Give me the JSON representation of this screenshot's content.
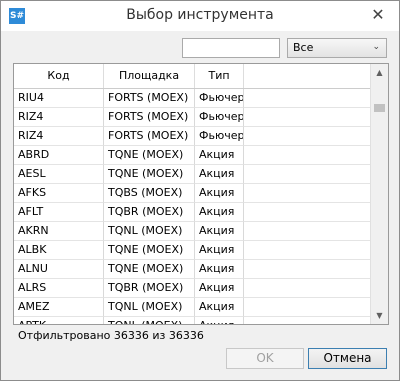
{
  "window": {
    "app_icon": "S#",
    "title": "Выбор инструмента",
    "close": "✕"
  },
  "filter": {
    "search_value": "",
    "combo_value": "Все"
  },
  "columns": [
    "Код",
    "Площадка",
    "Тип"
  ],
  "rows": [
    [
      "RIU4",
      "FORTS (MOEX)",
      "Фьючер"
    ],
    [
      "RIZ4",
      "FORTS (MOEX)",
      "Фьючер"
    ],
    [
      "RIZ4",
      "FORTS (MOEX)",
      "Фьючер"
    ],
    [
      "ABRD",
      "TQNE (MOEX)",
      "Акция"
    ],
    [
      "AESL",
      "TQNE (MOEX)",
      "Акция"
    ],
    [
      "AFKS",
      "TQBS (MOEX)",
      "Акция"
    ],
    [
      "AFLT",
      "TQBR (MOEX)",
      "Акция"
    ],
    [
      "AKRN",
      "TQNL (MOEX)",
      "Акция"
    ],
    [
      "ALBK",
      "TQNE (MOEX)",
      "Акция"
    ],
    [
      "ALNU",
      "TQNE (MOEX)",
      "Акция"
    ],
    [
      "ALRS",
      "TQBR (MOEX)",
      "Акция"
    ],
    [
      "AMEZ",
      "TQNL (MOEX)",
      "Акция"
    ],
    [
      "APTK",
      "TQNL (MOEX)",
      "Акция"
    ]
  ],
  "status": "Отфильтровано 36336 из 36336",
  "buttons": {
    "ok": "OK",
    "cancel": "Отмена"
  }
}
